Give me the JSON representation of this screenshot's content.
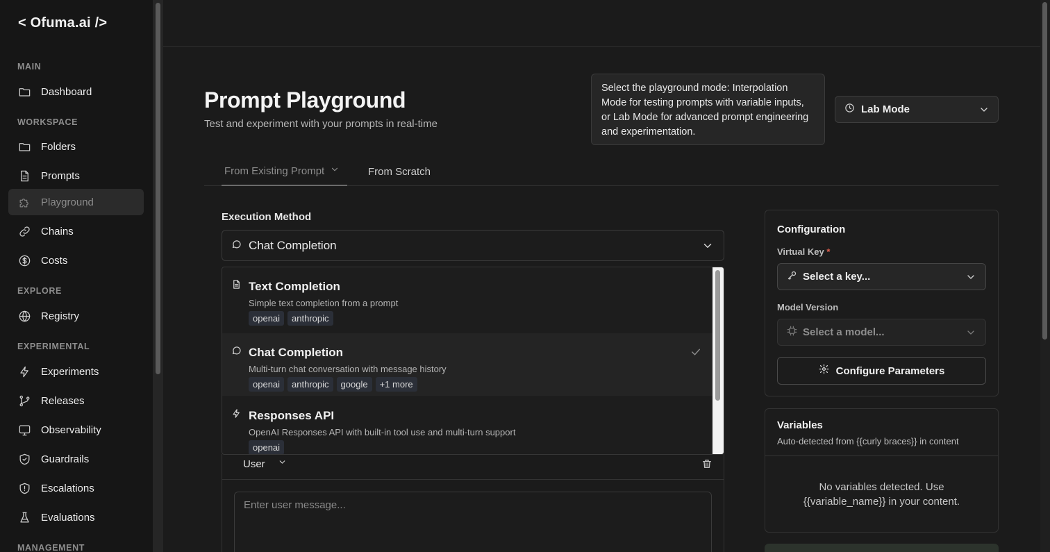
{
  "sidebar": {
    "logo": "< Ofuma.ai />",
    "sections": {
      "main": "MAIN",
      "workspace": "WORKSPACE",
      "explore": "EXPLORE",
      "experimental": "EXPERIMENTAL",
      "management": "MANAGEMENT"
    },
    "items": {
      "dashboard": "Dashboard",
      "folders": "Folders",
      "prompts": "Prompts",
      "playground": "Playground",
      "chains": "Chains",
      "costs": "Costs",
      "registry": "Registry",
      "experiments": "Experiments",
      "releases": "Releases",
      "observability": "Observability",
      "guardrails": "Guardrails",
      "escalations": "Escalations",
      "evaluations": "Evaluations"
    }
  },
  "header": {
    "title": "Prompt Playground",
    "subtitle": "Test and experiment with your prompts in real-time"
  },
  "mode": {
    "tooltip": "Select the playground mode: Interpolation Mode for testing prompts with variable inputs, or Lab Mode for advanced prompt engineering and experimentation.",
    "selected": "Lab Mode"
  },
  "tabs": {
    "existing": "From Existing Prompt",
    "scratch": "From Scratch"
  },
  "execution": {
    "label": "Execution Method",
    "selected": "Chat Completion",
    "options": [
      {
        "title": "Text Completion",
        "description": "Simple text completion from a prompt",
        "tags": [
          "openai",
          "anthropic"
        ]
      },
      {
        "title": "Chat Completion",
        "description": "Multi-turn chat conversation with message history",
        "tags": [
          "openai",
          "anthropic",
          "google",
          "+1 more"
        ]
      },
      {
        "title": "Responses API",
        "description": "OpenAI Responses API with built-in tool use and multi-turn support",
        "tags": [
          "openai"
        ]
      }
    ]
  },
  "message": {
    "role": "User",
    "placeholder": "Enter user message..."
  },
  "configuration": {
    "title": "Configuration",
    "virtual_key_label": "Virtual Key",
    "required_mark": "*",
    "virtual_key_placeholder": "Select a key...",
    "model_label": "Model Version",
    "model_placeholder": "Select a model...",
    "configure_button": "Configure Parameters"
  },
  "variables": {
    "title": "Variables",
    "subtitle": "Auto-detected from {{curly braces}} in content",
    "empty_line1": "No variables detected. Use",
    "empty_line2": "{{variable_name}} in your content."
  }
}
